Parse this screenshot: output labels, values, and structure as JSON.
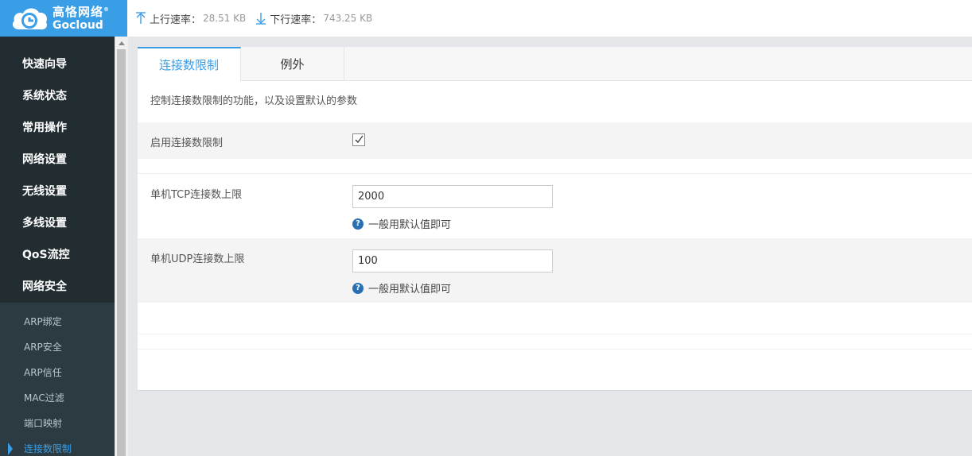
{
  "logo": {
    "cn": "高恪网络",
    "en": "Gocloud",
    "reg": "®"
  },
  "topbar": {
    "upload_label": "上行速率：",
    "upload_value": "28.51 KB",
    "download_label": "下行速率：",
    "download_value": "743.25 KB"
  },
  "sidebar": {
    "items": [
      {
        "label": "快速向导"
      },
      {
        "label": "系统状态"
      },
      {
        "label": "常用操作"
      },
      {
        "label": "网络设置"
      },
      {
        "label": "无线设置"
      },
      {
        "label": "多线设置"
      },
      {
        "label": "QoS流控"
      },
      {
        "label": "网络安全"
      }
    ],
    "subitems": [
      {
        "label": "ARP绑定"
      },
      {
        "label": "ARP安全"
      },
      {
        "label": "ARP信任"
      },
      {
        "label": "MAC过滤"
      },
      {
        "label": "端口映射"
      },
      {
        "label": "连接数限制"
      }
    ]
  },
  "tabs": [
    {
      "label": "连接数限制"
    },
    {
      "label": "例外"
    }
  ],
  "description": "控制连接数限制的功能，以及设置默认的参数",
  "form": {
    "enable_label": "启用连接数限制",
    "enable_checked": true,
    "tcp_label": "单机TCP连接数上限",
    "tcp_value": "2000",
    "tcp_hint": "一般用默认值即可",
    "udp_label": "单机UDP连接数上限",
    "udp_value": "100",
    "udp_hint": "一般用默认值即可"
  },
  "colors": {
    "accent": "#3a9ee6",
    "sidebar_bg": "#222d32",
    "help_icon": "#2a6fb3"
  }
}
